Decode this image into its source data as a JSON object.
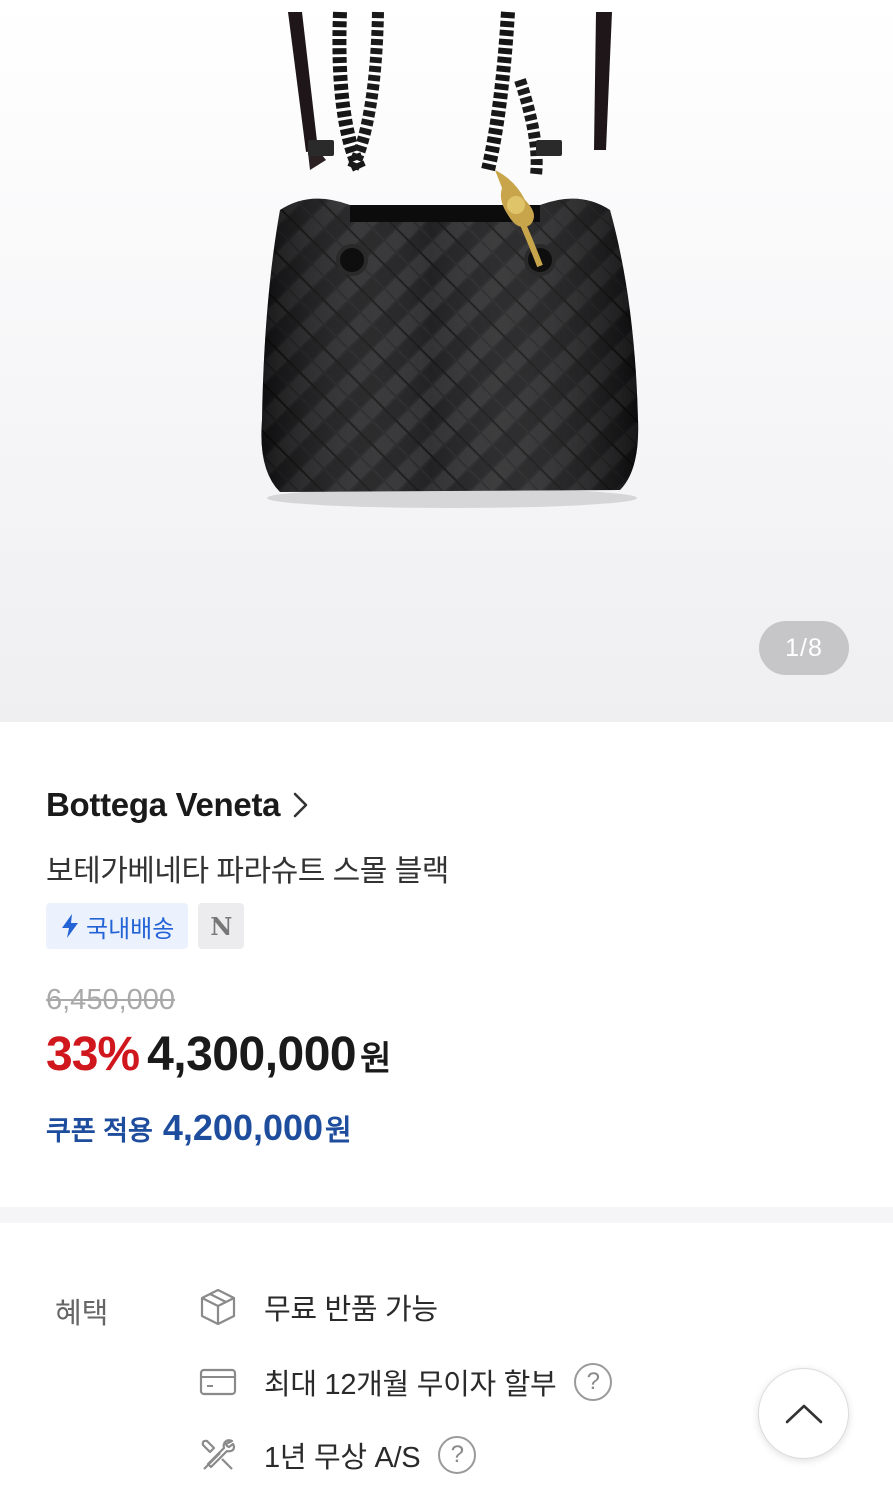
{
  "gallery": {
    "image_alt": "Bottega Veneta Parachute Small Black bag",
    "page_indicator": "1/8",
    "current_page": 1,
    "total_pages": 8
  },
  "product": {
    "brand": "Bottega Veneta",
    "title": "보테가베네타 파라슈트 스몰 블랙",
    "badges": {
      "domestic_shipping": "국내배송",
      "n_badge": "N"
    },
    "original_price": "6,450,000",
    "discount_rate": "33%",
    "sale_price": "4,300,000",
    "currency": "원",
    "coupon_label": "쿠폰 적용",
    "coupon_price": "4,200,000",
    "coupon_currency": "원"
  },
  "benefits": {
    "label": "혜택",
    "items": [
      {
        "icon": "box-icon",
        "text": "무료 반품 가능",
        "help": false
      },
      {
        "icon": "card-icon",
        "text": "최대 12개월 무이자 할부",
        "help": true
      },
      {
        "icon": "tools-icon",
        "text": "1년 무상 A/S",
        "help": true
      }
    ],
    "help_symbol": "?"
  },
  "colors": {
    "discount": "#d0171d",
    "coupon": "#1f4d9d",
    "badge_blue": "#2463d6",
    "indicator_bg": "#c6c6c9"
  }
}
